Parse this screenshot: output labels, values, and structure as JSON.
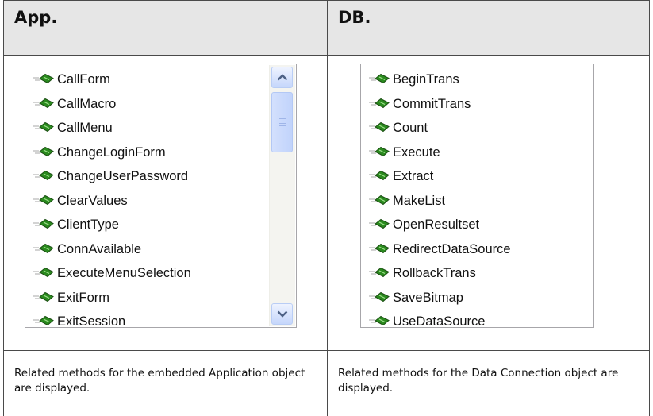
{
  "headers": {
    "left": "App.",
    "right": "DB."
  },
  "app_list": {
    "items": [
      "CallForm",
      "CallMacro",
      "CallMenu",
      "ChangeLoginForm",
      "ChangeUserPassword",
      "ClearValues",
      "ClientType",
      "ConnAvailable",
      "ExecuteMenuSelection",
      "ExitForm",
      "ExitSession"
    ]
  },
  "db_list": {
    "items": [
      "BeginTrans",
      "CommitTrans",
      "Count",
      "Execute",
      "Extract",
      "MakeList",
      "OpenResultset",
      "RedirectDataSource",
      "RollbackTrans",
      "SaveBitmap",
      "UseDataSource"
    ]
  },
  "footers": {
    "left": "Related methods for the embedded Application object are displayed.",
    "right": "Related methods for the Data Connection object are displayed."
  },
  "icon": "method-icon",
  "colors": {
    "header_bg": "#e6e6e6",
    "method_icon_green": "#2a8a1e",
    "scroll_accent": "#c5d6fb"
  }
}
